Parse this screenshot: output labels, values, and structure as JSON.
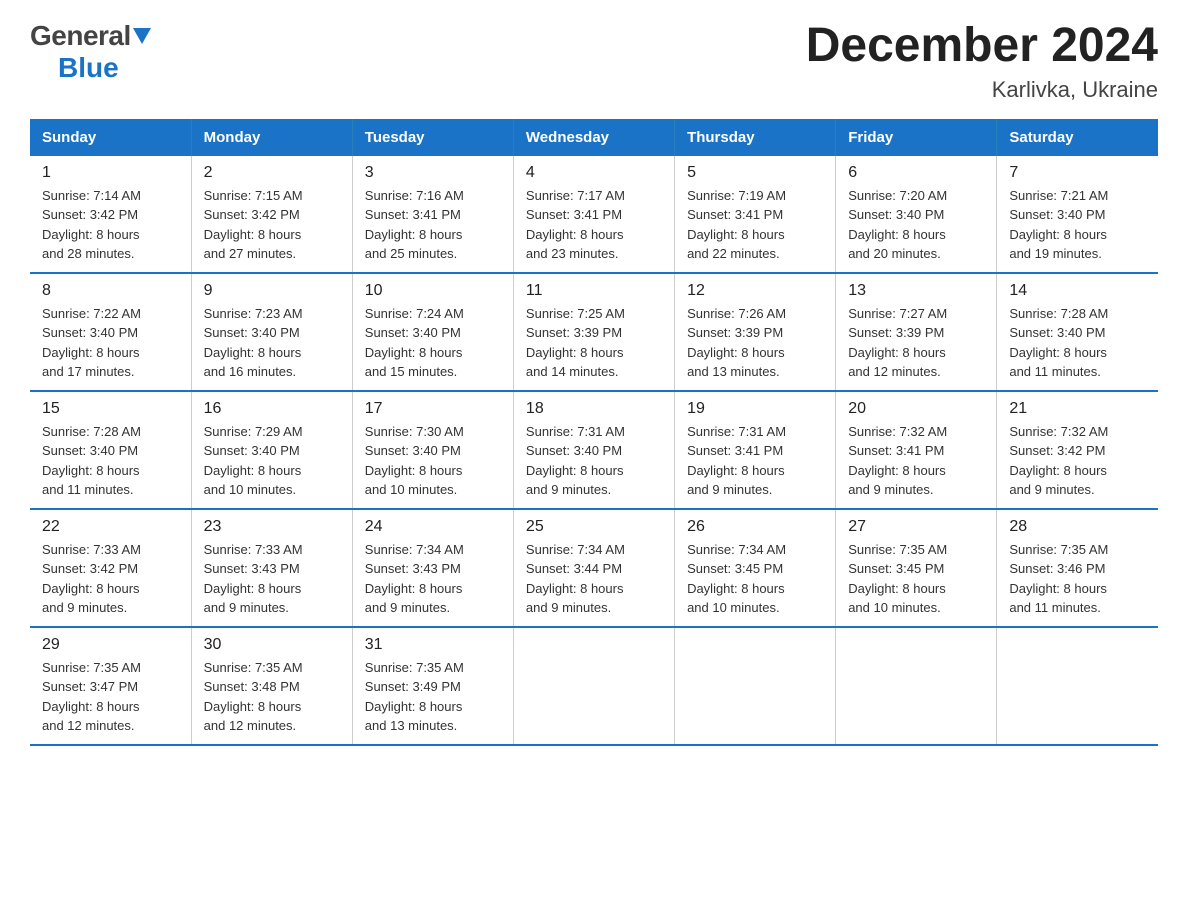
{
  "header": {
    "title": "December 2024",
    "subtitle": "Karlivka, Ukraine",
    "logo_general": "General",
    "logo_blue": "Blue"
  },
  "days_of_week": [
    "Sunday",
    "Monday",
    "Tuesday",
    "Wednesday",
    "Thursday",
    "Friday",
    "Saturday"
  ],
  "weeks": [
    [
      {
        "day": "1",
        "sunrise": "7:14 AM",
        "sunset": "3:42 PM",
        "daylight": "8 hours and 28 minutes."
      },
      {
        "day": "2",
        "sunrise": "7:15 AM",
        "sunset": "3:42 PM",
        "daylight": "8 hours and 27 minutes."
      },
      {
        "day": "3",
        "sunrise": "7:16 AM",
        "sunset": "3:41 PM",
        "daylight": "8 hours and 25 minutes."
      },
      {
        "day": "4",
        "sunrise": "7:17 AM",
        "sunset": "3:41 PM",
        "daylight": "8 hours and 23 minutes."
      },
      {
        "day": "5",
        "sunrise": "7:19 AM",
        "sunset": "3:41 PM",
        "daylight": "8 hours and 22 minutes."
      },
      {
        "day": "6",
        "sunrise": "7:20 AM",
        "sunset": "3:40 PM",
        "daylight": "8 hours and 20 minutes."
      },
      {
        "day": "7",
        "sunrise": "7:21 AM",
        "sunset": "3:40 PM",
        "daylight": "8 hours and 19 minutes."
      }
    ],
    [
      {
        "day": "8",
        "sunrise": "7:22 AM",
        "sunset": "3:40 PM",
        "daylight": "8 hours and 17 minutes."
      },
      {
        "day": "9",
        "sunrise": "7:23 AM",
        "sunset": "3:40 PM",
        "daylight": "8 hours and 16 minutes."
      },
      {
        "day": "10",
        "sunrise": "7:24 AM",
        "sunset": "3:40 PM",
        "daylight": "8 hours and 15 minutes."
      },
      {
        "day": "11",
        "sunrise": "7:25 AM",
        "sunset": "3:39 PM",
        "daylight": "8 hours and 14 minutes."
      },
      {
        "day": "12",
        "sunrise": "7:26 AM",
        "sunset": "3:39 PM",
        "daylight": "8 hours and 13 minutes."
      },
      {
        "day": "13",
        "sunrise": "7:27 AM",
        "sunset": "3:39 PM",
        "daylight": "8 hours and 12 minutes."
      },
      {
        "day": "14",
        "sunrise": "7:28 AM",
        "sunset": "3:40 PM",
        "daylight": "8 hours and 11 minutes."
      }
    ],
    [
      {
        "day": "15",
        "sunrise": "7:28 AM",
        "sunset": "3:40 PM",
        "daylight": "8 hours and 11 minutes."
      },
      {
        "day": "16",
        "sunrise": "7:29 AM",
        "sunset": "3:40 PM",
        "daylight": "8 hours and 10 minutes."
      },
      {
        "day": "17",
        "sunrise": "7:30 AM",
        "sunset": "3:40 PM",
        "daylight": "8 hours and 10 minutes."
      },
      {
        "day": "18",
        "sunrise": "7:31 AM",
        "sunset": "3:40 PM",
        "daylight": "8 hours and 9 minutes."
      },
      {
        "day": "19",
        "sunrise": "7:31 AM",
        "sunset": "3:41 PM",
        "daylight": "8 hours and 9 minutes."
      },
      {
        "day": "20",
        "sunrise": "7:32 AM",
        "sunset": "3:41 PM",
        "daylight": "8 hours and 9 minutes."
      },
      {
        "day": "21",
        "sunrise": "7:32 AM",
        "sunset": "3:42 PM",
        "daylight": "8 hours and 9 minutes."
      }
    ],
    [
      {
        "day": "22",
        "sunrise": "7:33 AM",
        "sunset": "3:42 PM",
        "daylight": "8 hours and 9 minutes."
      },
      {
        "day": "23",
        "sunrise": "7:33 AM",
        "sunset": "3:43 PM",
        "daylight": "8 hours and 9 minutes."
      },
      {
        "day": "24",
        "sunrise": "7:34 AM",
        "sunset": "3:43 PM",
        "daylight": "8 hours and 9 minutes."
      },
      {
        "day": "25",
        "sunrise": "7:34 AM",
        "sunset": "3:44 PM",
        "daylight": "8 hours and 9 minutes."
      },
      {
        "day": "26",
        "sunrise": "7:34 AM",
        "sunset": "3:45 PM",
        "daylight": "8 hours and 10 minutes."
      },
      {
        "day": "27",
        "sunrise": "7:35 AM",
        "sunset": "3:45 PM",
        "daylight": "8 hours and 10 minutes."
      },
      {
        "day": "28",
        "sunrise": "7:35 AM",
        "sunset": "3:46 PM",
        "daylight": "8 hours and 11 minutes."
      }
    ],
    [
      {
        "day": "29",
        "sunrise": "7:35 AM",
        "sunset": "3:47 PM",
        "daylight": "8 hours and 12 minutes."
      },
      {
        "day": "30",
        "sunrise": "7:35 AM",
        "sunset": "3:48 PM",
        "daylight": "8 hours and 12 minutes."
      },
      {
        "day": "31",
        "sunrise": "7:35 AM",
        "sunset": "3:49 PM",
        "daylight": "8 hours and 13 minutes."
      },
      null,
      null,
      null,
      null
    ]
  ],
  "labels": {
    "sunrise_prefix": "Sunrise: ",
    "sunset_prefix": "Sunset: ",
    "daylight_prefix": "Daylight: "
  }
}
